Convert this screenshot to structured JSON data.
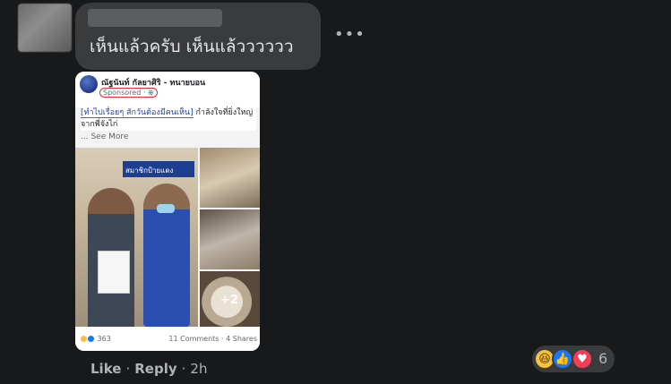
{
  "comment": {
    "text": "เห็นแล้วครับ เห็นแล้วววววว",
    "more_icon": "more-options-icon"
  },
  "shared_post": {
    "page_name": "ณัฐนันท์ กัลยาศิริ - ทนายบอน",
    "sponsored_label": "Sponsored · ⊕",
    "caption_highlight": "[ทำไปเรื่อยๆ สักวันต้องมีคนเห็น]",
    "caption_rest": " กำลังใจที่ยิ่งใหญ่จากพี่จังไก่",
    "see_more": "... See More",
    "banner_text": "สมาชิกป้ายแดง",
    "more_photos": "+2",
    "reaction_count": "363",
    "comments_shares": "11 Comments · 4 Shares"
  },
  "reactions": {
    "icons": [
      "haha-icon",
      "like-icon",
      "love-icon"
    ],
    "count": "6"
  },
  "actions": {
    "like": "Like",
    "reply": "Reply",
    "time": "2h"
  },
  "colors": {
    "background": "#18191a",
    "bubble": "#3a3b3c",
    "text": "#e4e6eb",
    "muted": "#b0b3b8"
  }
}
